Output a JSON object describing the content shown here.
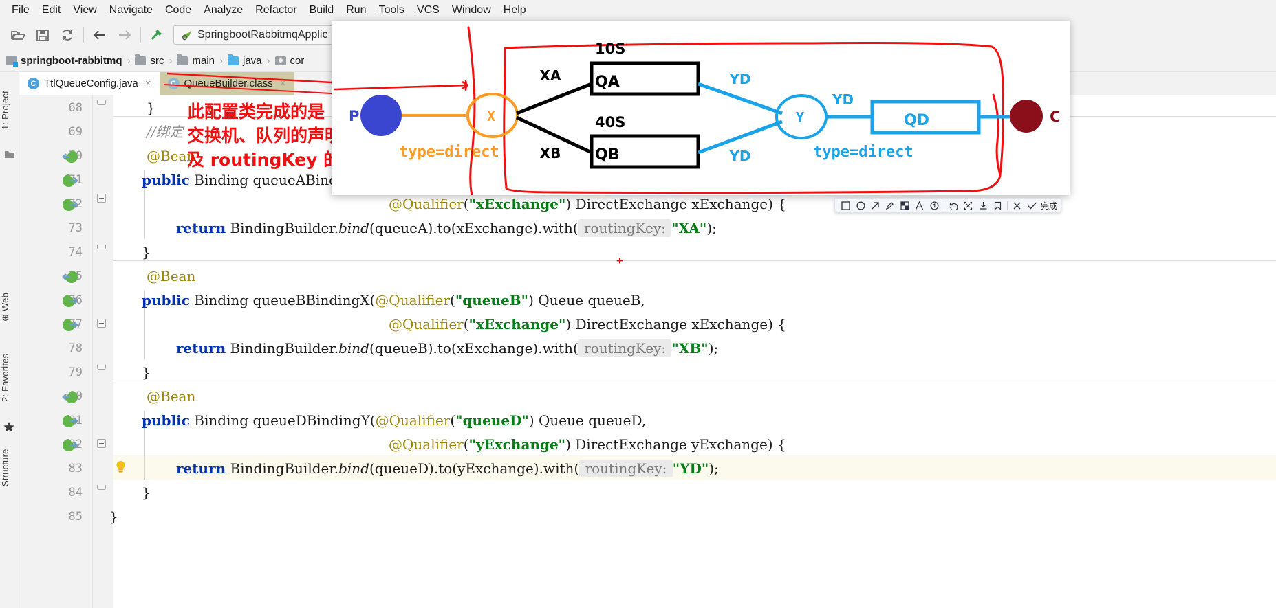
{
  "menu": {
    "items": [
      {
        "label": "File",
        "mn": "F"
      },
      {
        "label": "Edit",
        "mn": "E"
      },
      {
        "label": "View",
        "mn": "V"
      },
      {
        "label": "Navigate",
        "mn": "N"
      },
      {
        "label": "Code",
        "mn": "C"
      },
      {
        "label": "Analyze",
        "mn": "z"
      },
      {
        "label": "Refactor",
        "mn": "R"
      },
      {
        "label": "Build",
        "mn": "B"
      },
      {
        "label": "Run",
        "mn": "R"
      },
      {
        "label": "Tools",
        "mn": "T"
      },
      {
        "label": "VCS",
        "mn": "V"
      },
      {
        "label": "Window",
        "mn": "W"
      },
      {
        "label": "Help",
        "mn": "H"
      }
    ]
  },
  "toolbar": {
    "icons": [
      "open-folder-icon",
      "save-icon",
      "sync-icon",
      "back-arrow-icon",
      "forward-arrow-icon",
      "build-hammer-icon"
    ],
    "run_configuration": "SpringbootRabbitmqApplic"
  },
  "breadcrumb": {
    "items": [
      {
        "label": "springboot-rabbitmq",
        "icon": "module-icon"
      },
      {
        "label": "src",
        "icon": "folder-icon"
      },
      {
        "label": "main",
        "icon": "folder-icon"
      },
      {
        "label": "java",
        "icon": "folder-blue-icon"
      },
      {
        "label": "cor",
        "icon": "package-icon"
      }
    ],
    "separator": "›"
  },
  "rail": {
    "items": [
      {
        "label": "1: Project",
        "icon": "project-icon"
      },
      {
        "label": "⊕ Web",
        "icon": "web-icon"
      },
      {
        "label": "2: Favorites",
        "icon": "star-icon"
      },
      {
        "label": "Structure",
        "icon": "structure-icon"
      }
    ]
  },
  "tabs": [
    {
      "label": "TtlQueueConfig.java",
      "icon": "java-class-icon",
      "close": "×",
      "active": true
    },
    {
      "label": "QueueBuilder.class",
      "icon": "java-class-decompiled-icon",
      "close": "×",
      "active": false
    }
  ],
  "editor": {
    "lines": [
      {
        "num": "68",
        "text": "}",
        "marker": null
      },
      {
        "num": "69",
        "text": "//绑定",
        "marker": null
      },
      {
        "num": "70",
        "text": "@Bean",
        "marker": "bean-in-icon"
      },
      {
        "num": "71",
        "text": "public Binding queueABind",
        "marker": "bean-out-icon"
      },
      {
        "num": "72",
        "text": "@Qualifier(\"xExchange\") DirectExchange xExchange) {",
        "marker": "bean-out-icon"
      },
      {
        "num": "73",
        "text": "return BindingBuilder.bind(queueA).to(xExchange).with( routingKey: \"XA\");",
        "marker": null
      },
      {
        "num": "74",
        "text": "}",
        "marker": null
      },
      {
        "num": "75",
        "text": "@Bean",
        "marker": "bean-in-icon"
      },
      {
        "num": "76",
        "text": "public Binding queueBBindingX(@Qualifier(\"queueB\") Queue queueB,",
        "marker": "bean-out-icon"
      },
      {
        "num": "77",
        "text": "@Qualifier(\"xExchange\") DirectExchange xExchange) {",
        "marker": "bean-out-icon"
      },
      {
        "num": "78",
        "text": "return BindingBuilder.bind(queueB).to(xExchange).with( routingKey: \"XB\");",
        "marker": null
      },
      {
        "num": "79",
        "text": "}",
        "marker": null
      },
      {
        "num": "80",
        "text": "@Bean",
        "marker": "bean-in-icon"
      },
      {
        "num": "81",
        "text": "public Binding queueDBindingY(@Qualifier(\"queueD\") Queue queueD,",
        "marker": "bean-out-icon"
      },
      {
        "num": "82",
        "text": "@Qualifier(\"yExchange\") DirectExchange yExchange) {",
        "marker": "bean-out-icon"
      },
      {
        "num": "83",
        "text": "return BindingBuilder.bind(queueD).to(yExchange).with( routingKey: \"YD\");",
        "marker": "intention-bulb-icon"
      },
      {
        "num": "84",
        "text": "}",
        "marker": null
      },
      {
        "num": "85",
        "text": "}",
        "marker": null
      }
    ],
    "tokens": {
      "kw_public": "public",
      "type_binding": "Binding",
      "kw_return": "return",
      "builder": "BindingBuilder.",
      "bind": "bind",
      "ann_bean": "@Bean",
      "ann_qualifier": "@Qualifier",
      "type_queue": "Queue",
      "type_direct_exchange": "DirectExchange",
      "hint_routing_key": "routingKey:",
      "comment_binding": "//绑定"
    }
  },
  "annotation_note": {
    "line1": "此配置类完成的是",
    "line2": "交换机、队列的声明",
    "line3": "及 routingKey 的绑定",
    "color": "#f01010"
  },
  "diagram": {
    "producer_label": "P",
    "consumer_label": "C",
    "exchange_x": "X",
    "exchange_y": "Y",
    "x_type": "type=direct",
    "y_type": "type=direct",
    "queue_a": "QA",
    "queue_b": "QB",
    "queue_d": "QD",
    "ttl_a": "10S",
    "ttl_b": "40S",
    "key_xa": "XA",
    "key_xb": "XB",
    "key_yd_a": "YD",
    "key_yd_b": "YD",
    "key_yd_out": "YD",
    "colors": {
      "producer": "#3a46cf",
      "consumer": "#8b0f1a",
      "exchange_x": "#ff9a22",
      "blue": "#1aa3e8",
      "black": "#000000",
      "red_pen": "#ee1111"
    }
  },
  "anno_toolbar": {
    "tools": [
      {
        "name": "rectangle-tool",
        "glyph": "□"
      },
      {
        "name": "ellipse-tool",
        "glyph": "○"
      },
      {
        "name": "arrow-tool",
        "glyph": "↗"
      },
      {
        "name": "pen-tool",
        "glyph": "✎"
      },
      {
        "name": "mosaic-tool",
        "glyph": "◨"
      },
      {
        "name": "text-tool",
        "glyph": "A"
      },
      {
        "name": "number-tool",
        "glyph": "①"
      },
      {
        "name": "undo-tool",
        "glyph": "↺"
      },
      {
        "name": "ocr-tool",
        "glyph": "⌘"
      },
      {
        "name": "download-tool",
        "glyph": "⤓"
      },
      {
        "name": "pin-tool",
        "glyph": "⚑"
      },
      {
        "name": "close-tool",
        "glyph": "✕"
      },
      {
        "name": "confirm-tool",
        "glyph": "✓"
      }
    ],
    "done_label": "完成"
  }
}
